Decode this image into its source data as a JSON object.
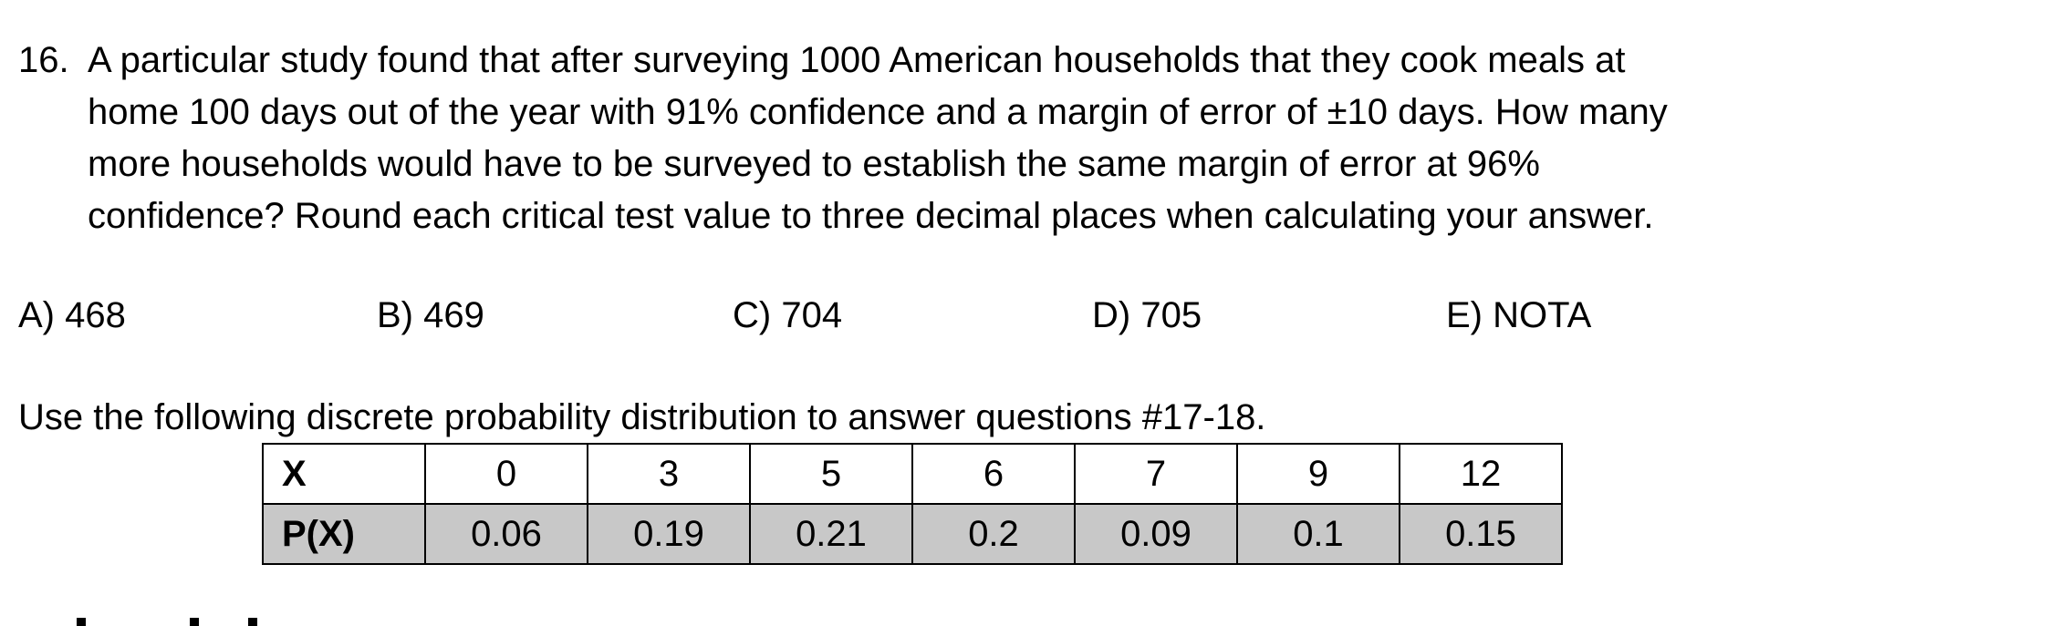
{
  "question": {
    "number": "16.",
    "lines": [
      "A particular study found that after surveying 1000 American households that they cook meals at",
      "home 100 days out of the year with 91% confidence and a margin of error of ±10 days. How many",
      "more households would have to be surveyed to establish the same margin of error at 96%",
      "confidence? Round each critical test value to three decimal places when calculating your answer."
    ],
    "choices": [
      "A) 468",
      "B) 469",
      "C) 704",
      "D) 705",
      "E) NOTA"
    ]
  },
  "instruction": "Use the following discrete probability distribution to answer questions #17-18.",
  "distribution": {
    "x_header": "X",
    "p_header": "P(X)",
    "x_values": [
      "0",
      "3",
      "5",
      "6",
      "7",
      "9",
      "12"
    ],
    "p_values": [
      "0.06",
      "0.19",
      "0.21",
      "0.2",
      "0.09",
      "0.1",
      "0.15"
    ]
  },
  "colors": {
    "probability_row_fill": "#c8c8c8"
  }
}
